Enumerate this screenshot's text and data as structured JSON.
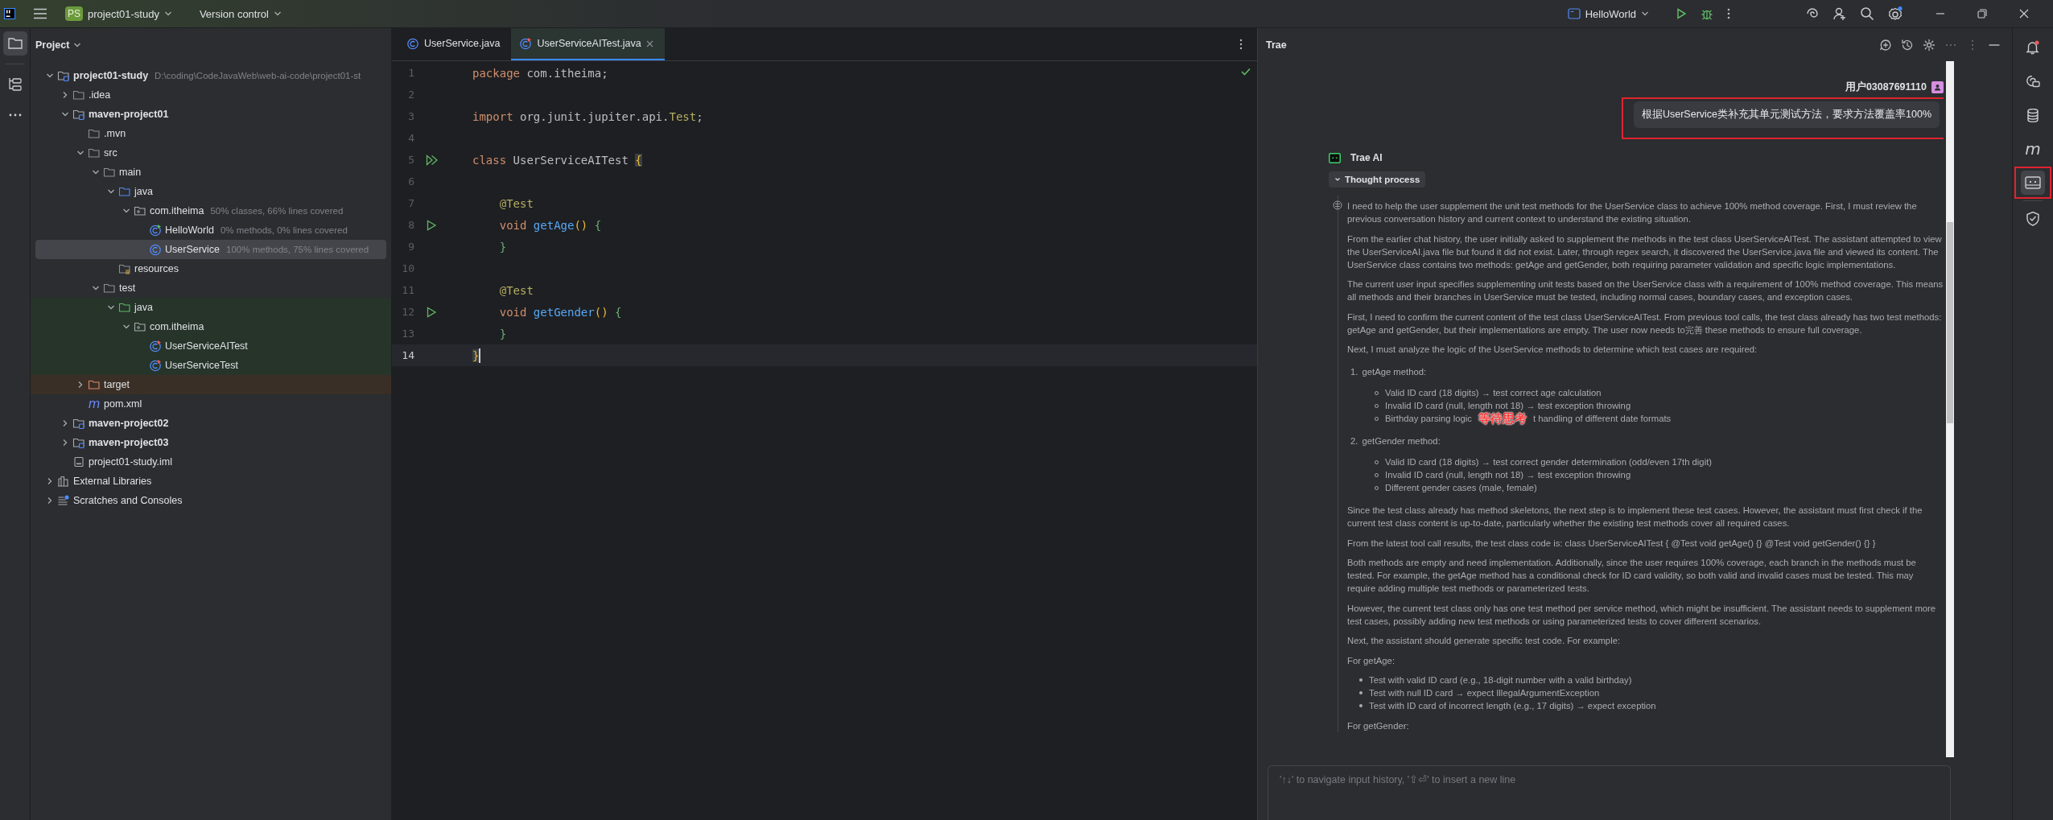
{
  "title_bar": {
    "project_badge": "PS",
    "project": "project01-study",
    "vcs": "Version control",
    "run_config": "HelloWorld"
  },
  "left_tools": [
    {
      "kind": "folder",
      "selected": true
    },
    {
      "kind": "structure",
      "selected": false
    },
    {
      "kind": "more",
      "selected": false
    }
  ],
  "project_panel": {
    "title": "Project",
    "tree": [
      {
        "name": "project01-study",
        "kind": "module",
        "hint": "D:\\coding\\CodeJavaWeb\\web-ai-code\\project01-st",
        "expanded": true,
        "selected": false,
        "children": [
          {
            "name": ".idea",
            "kind": "folder",
            "expanded": false,
            "selected": false
          },
          {
            "name": "maven-project01",
            "kind": "module",
            "expanded": true,
            "selected": false,
            "children": [
              {
                "name": ".mvn",
                "kind": "folder",
                "selected": false
              },
              {
                "name": "src",
                "kind": "folder",
                "expanded": true,
                "selected": false,
                "children": [
                  {
                    "name": "main",
                    "kind": "folder",
                    "expanded": true,
                    "selected": false,
                    "children": [
                      {
                        "name": "java",
                        "kind": "source_root",
                        "expanded": true,
                        "selected": false,
                        "children": [
                          {
                            "name": "com.itheima",
                            "kind": "package",
                            "hint": "50% classes, 66% lines covered",
                            "expanded": true,
                            "selected": false,
                            "children": [
                              {
                                "name": "HelloWorld",
                                "kind": "main_class",
                                "hint": "0% methods, 0% lines covered",
                                "selected": false
                              },
                              {
                                "name": "UserService",
                                "kind": "class",
                                "hint": "100% methods, 75% lines covered",
                                "selected": true
                              }
                            ]
                          }
                        ]
                      },
                      {
                        "name": "resources",
                        "kind": "resources",
                        "selected": false
                      }
                    ]
                  },
                  {
                    "name": "test",
                    "kind": "folder",
                    "expanded": true,
                    "selected": false,
                    "children": [
                      {
                        "name": "java",
                        "kind": "test_root",
                        "test_source": true,
                        "expanded": true,
                        "selected": false,
                        "children": [
                          {
                            "name": "com.itheima",
                            "kind": "package",
                            "test_source": true,
                            "expanded": true,
                            "selected": false,
                            "children": [
                              {
                                "name": "UserServiceAITest",
                                "kind": "test_class",
                                "test_source": true,
                                "selected": false
                              },
                              {
                                "name": "UserServiceTest",
                                "kind": "test_class",
                                "test_source": true,
                                "selected": false
                              }
                            ]
                          }
                        ]
                      }
                    ]
                  }
                ]
              },
              {
                "name": "target",
                "kind": "excluded",
                "excluded": true,
                "expanded": false,
                "selected": false
              },
              {
                "name": "pom.xml",
                "kind": "pom",
                "icon_text": "m",
                "selected": false
              }
            ]
          },
          {
            "name": "maven-project02",
            "kind": "module",
            "expanded": false,
            "selected": false
          },
          {
            "name": "maven-project03",
            "kind": "module",
            "expanded": false,
            "selected": false
          },
          {
            "name": "project01-study.iml",
            "kind": "iml",
            "selected": false
          }
        ]
      },
      {
        "name": "External Libraries",
        "kind": "libraries",
        "expanded": false,
        "selected": false
      },
      {
        "name": "Scratches and Consoles",
        "kind": "scratches",
        "expanded": false,
        "selected": false
      }
    ]
  },
  "editor": {
    "tabs": [
      {
        "label": "UserService.java",
        "kind": "class",
        "selected": false
      },
      {
        "label": "UserServiceAITest.java",
        "kind": "test_class",
        "selected": true
      }
    ],
    "lines": [
      {
        "number": "1",
        "current": false,
        "tokens": [
          {
            "t": "package ",
            "kind": "keyword"
          },
          {
            "t": "com.itheima;",
            "kind": "plain"
          }
        ]
      },
      {
        "number": "2",
        "current": false
      },
      {
        "number": "3",
        "current": false,
        "tokens": [
          {
            "t": "import ",
            "kind": "keyword"
          },
          {
            "t": "org.junit.jupiter.api.",
            "kind": "plain"
          },
          {
            "t": "Test",
            "kind": "type"
          },
          {
            "t": ";",
            "kind": "plain"
          }
        ]
      },
      {
        "number": "4",
        "current": false
      },
      {
        "number": "5",
        "current": false,
        "gutter": {
          "kind": "run_all"
        },
        "tokens": [
          {
            "t": "class ",
            "kind": "keyword"
          },
          {
            "t": "UserServiceAITest ",
            "kind": "plain"
          },
          {
            "t": "{",
            "kind": "matched"
          }
        ]
      },
      {
        "number": "6",
        "current": false
      },
      {
        "number": "7",
        "current": false,
        "tokens": [
          {
            "t": "    @Test",
            "kind": "annotation"
          }
        ]
      },
      {
        "number": "8",
        "current": false,
        "gutter": {
          "kind": "run"
        },
        "tokens": [
          {
            "t": "    void ",
            "kind": "keyword"
          },
          {
            "t": "getAge",
            "kind": "function"
          },
          {
            "t": "() ",
            "kind": "paren"
          },
          {
            "t": "{",
            "kind": "brace"
          }
        ]
      },
      {
        "number": "9",
        "current": false,
        "tokens": [
          {
            "t": "    }",
            "kind": "brace"
          }
        ]
      },
      {
        "number": "10",
        "current": false
      },
      {
        "number": "11",
        "current": false,
        "tokens": [
          {
            "t": "    @Test",
            "kind": "annotation"
          }
        ]
      },
      {
        "number": "12",
        "current": false,
        "gutter": {
          "kind": "run"
        },
        "tokens": [
          {
            "t": "    void ",
            "kind": "keyword"
          },
          {
            "t": "getGender",
            "kind": "function"
          },
          {
            "t": "() ",
            "kind": "paren"
          },
          {
            "t": "{",
            "kind": "brace"
          }
        ]
      },
      {
        "number": "13",
        "current": false,
        "tokens": [
          {
            "t": "    }",
            "kind": "brace"
          }
        ]
      },
      {
        "number": "14",
        "current": true,
        "tokens": [
          {
            "t": "}",
            "kind": "matched"
          }
        ]
      }
    ]
  },
  "trae": {
    "title": "Trae",
    "user": "用户03087691110",
    "message": "根据UserService类补充其单元测试方法，要求方法覆盖率100%",
    "message_annotated": true,
    "assistant": "Trae AI",
    "thought_toggle": "Thought process",
    "thought_expanded": true,
    "thought": [
      {
        "kind": "p",
        "text": "I need to help the user supplement the unit test methods for the UserService class to achieve 100% method coverage. First, I must review the previous conversation history and current context to understand the existing situation."
      },
      {
        "kind": "p",
        "text": "From the earlier chat history, the user initially asked to supplement the methods in the test class UserServiceAITest. The assistant attempted to view the UserServiceAI.java file but found it did not exist. Later, through regex search, it discovered the UserService.java file and viewed its content. The UserService class contains two methods: getAge and getGender, both requiring parameter validation and specific logic implementations."
      },
      {
        "kind": "p",
        "text": "The current user input specifies supplementing unit tests based on the UserService class with a requirement of 100% method coverage. This means all methods and their branches in UserService must be tested, including normal cases, boundary cases, and exception cases."
      },
      {
        "kind": "p",
        "text": "First, I need to confirm the current content of the test class UserServiceAITest. From previous tool calls, the test class already has two test methods: getAge and getGender, but their implementations are empty. The user now needs to完善 these methods to ensure full coverage."
      },
      {
        "kind": "p",
        "text": "Next, I must analyze the logic of the UserService methods to determine which test cases are required:"
      },
      {
        "kind": "ol",
        "number": "1.",
        "text": "getAge method:",
        "bullets": [
          {
            "text": "Valid ID card (18 digits) → test correct age calculation"
          },
          {
            "text": "Invalid ID card (null, length not 18) → test exception throwing"
          },
          {
            "text": "Birthday parsing logic",
            "note": "等待思考",
            "rest": "t handling of different date formats"
          }
        ]
      },
      {
        "kind": "ol",
        "number": "2.",
        "text": "getGender method:",
        "bullets": [
          {
            "text": "Valid ID card (18 digits) → test correct gender determination (odd/even 17th digit)"
          },
          {
            "text": "Invalid ID card (null, length not 18) → test exception throwing"
          },
          {
            "text": "Different gender cases (male, female)"
          }
        ]
      },
      {
        "kind": "p",
        "text": "Since the test class already has method skeletons, the next step is to implement these test cases. However, the assistant must first check if the current test class content is up-to-date, particularly whether the existing test methods cover all required cases."
      },
      {
        "kind": "p",
        "text": "From the latest tool call results, the test class code is: class UserServiceAITest { @Test void getAge() {} @Test void getGender() {} }"
      },
      {
        "kind": "p",
        "text": "Both methods are empty and need implementation. Additionally, since the user requires 100% coverage, each branch in the methods must be tested. For example, the getAge method has a conditional check for ID card validity, so both valid and invalid cases must be tested. This may require adding multiple test methods or parameterized tests."
      },
      {
        "kind": "p",
        "text": "However, the current test class only has one test method per service method, which might be insufficient. The assistant needs to supplement more test cases, possibly adding new test methods or using parameterized tests to cover different scenarios."
      },
      {
        "kind": "p",
        "text": "Next, the assistant should generate specific test code. For example:"
      },
      {
        "kind": "p",
        "text": "For getAge:"
      },
      {
        "kind": "ul",
        "bullets": [
          {
            "text": "Test with valid ID card (e.g., 18-digit number with a valid birthday)"
          },
          {
            "text": "Test with null ID card → expect IllegalArgumentException"
          },
          {
            "text": "Test with ID card of incorrect length (e.g., 17 digits) → expect exception"
          }
        ]
      },
      {
        "kind": "p",
        "text": "For getGender:"
      }
    ],
    "input_placeholder": "'↑↓' to navigate input history, '⇧⏎' to insert a new line"
  },
  "right_tools": [
    {
      "kind": "bell",
      "selected": false,
      "annotated": false
    },
    {
      "kind": "chat",
      "selected": false,
      "annotated": false
    },
    {
      "kind": "database",
      "selected": false,
      "annotated": false
    },
    {
      "kind": "maven",
      "glyph": "m",
      "selected": false,
      "annotated": false
    },
    {
      "kind": "assistant",
      "selected": true,
      "annotated": true
    },
    {
      "kind": "shield",
      "selected": false,
      "annotated": false
    }
  ]
}
